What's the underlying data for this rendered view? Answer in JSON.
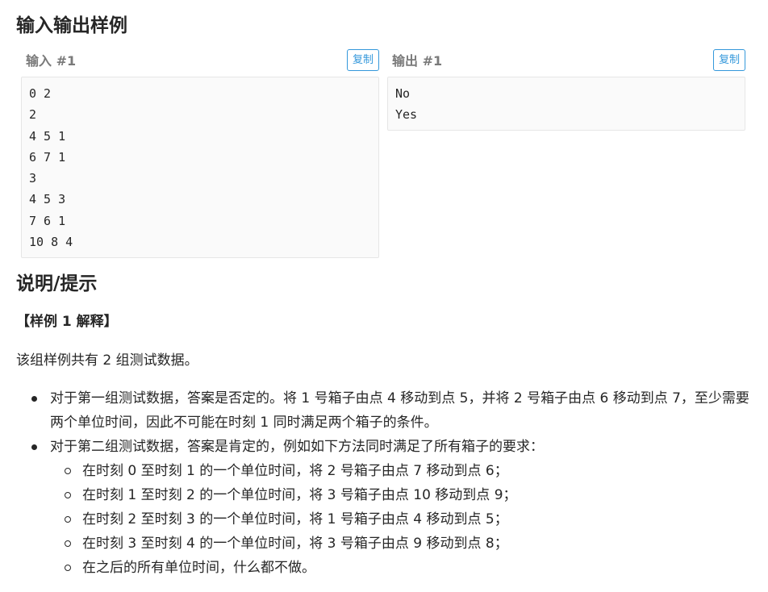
{
  "sample_section": {
    "title": "输入输出样例",
    "input": {
      "label": "输入 #1",
      "copy_label": "复制",
      "lines": [
        "0 2",
        "2",
        "4 5 1",
        "6 7 1",
        "3",
        "4 5 3",
        "7 6 1",
        "10 8 4"
      ]
    },
    "output": {
      "label": "输出 #1",
      "copy_label": "复制",
      "lines": [
        "No",
        "Yes"
      ]
    }
  },
  "hint_section": {
    "title": "说明/提示",
    "subheading": "【样例 1 解释】",
    "intro": "该组样例共有 2 组测试数据。",
    "bullets": [
      {
        "text": "对于第一组测试数据，答案是否定的。将 1 号箱子由点 4 移动到点 5，并将 2 号箱子由点 6 移动到点 7，至少需要两个单位时间，因此不可能在时刻 1 同时满足两个箱子的条件。"
      },
      {
        "text": "对于第二组测试数据，答案是肯定的，例如如下方法同时满足了所有箱子的要求：",
        "sub": [
          "在时刻 0 至时刻 1 的一个单位时间，将 2 号箱子由点 7 移动到点 6；",
          "在时刻 1 至时刻 2 的一个单位时间，将 3 号箱子由点 10 移动到点 9；",
          "在时刻 2 至时刻 3 的一个单位时间，将 1 号箱子由点 4 移动到点 5；",
          "在时刻 3 至时刻 4 的一个单位时间，将 3 号箱子由点 9 移动到点 8；",
          "在之后的所有单位时间，什么都不做。"
        ]
      }
    ]
  },
  "colors": {
    "accent": "#3498db",
    "text": "#262626",
    "muted_label": "#7a7a7a",
    "code_bg": "#fafafa",
    "code_border": "#e6e6e6"
  }
}
